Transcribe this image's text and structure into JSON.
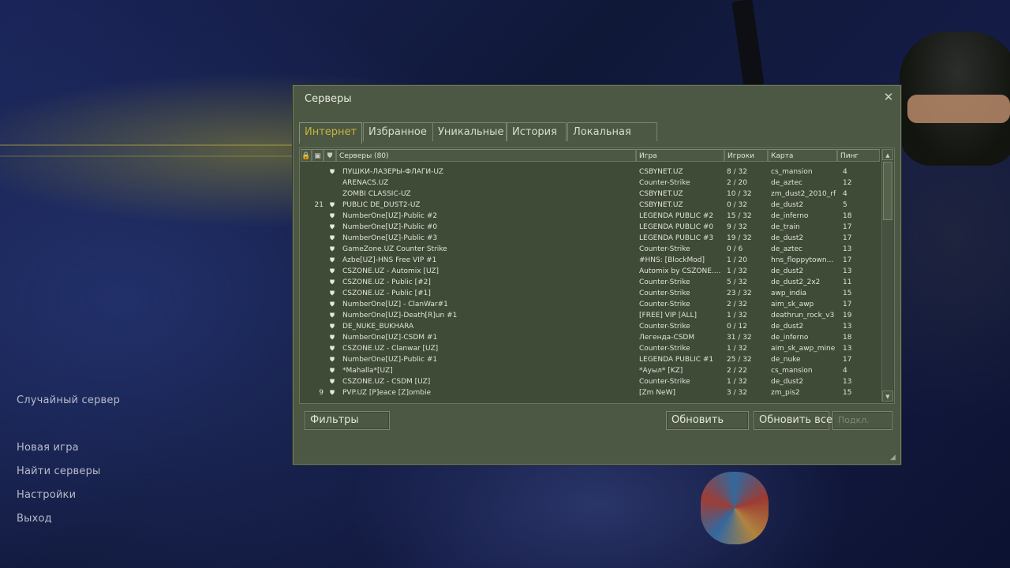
{
  "main_menu": {
    "random_server": "Случайный сервер",
    "items": [
      "Новая игра",
      "Найти серверы",
      "Настройки",
      "Выход"
    ]
  },
  "dialog": {
    "title": "Серверы",
    "close_icon": "close-icon",
    "tabs": [
      {
        "label": "Интернет",
        "active": true
      },
      {
        "label": "Избранное",
        "active": false
      },
      {
        "label": "Уникальные",
        "active": false
      },
      {
        "label": "История",
        "active": false
      },
      {
        "label": "Локальная сеть",
        "active": false
      }
    ],
    "columns": {
      "password_icon": "lock-icon",
      "bots_icon": "bot-icon",
      "secure_icon": "shield-icon",
      "servers": "Серверы (80)",
      "game": "Игра",
      "players": "Игроки",
      "map": "Карта",
      "ping": "Пинг"
    },
    "servers": [
      {
        "bots": "",
        "secure": true,
        "name": "ПУШКИ-ЛАЗЕРЫ-ФЛАГИ-UZ",
        "game": "CSBYNET.UZ",
        "players": "8 / 32",
        "map": "cs_mansion",
        "ping": "4"
      },
      {
        "bots": "",
        "secure": false,
        "name": "ARENACS.UZ",
        "game": "Counter-Strike",
        "players": "2 / 20",
        "map": "de_aztec",
        "ping": "12"
      },
      {
        "bots": "",
        "secure": false,
        "name": "ZOMBI CLASSIC-UZ",
        "game": "CSBYNET.UZ",
        "players": "10 / 32",
        "map": "zm_dust2_2010_rf",
        "ping": "4"
      },
      {
        "bots": "21",
        "secure": true,
        "name": "PUBLIC DE_DUST2-UZ",
        "game": "CSBYNET.UZ",
        "players": "0 / 32",
        "map": "de_dust2",
        "ping": "5"
      },
      {
        "bots": "",
        "secure": true,
        "name": "NumberOne[UZ]-Public #2",
        "game": "LEGENDA PUBLIC #2",
        "players": "15 / 32",
        "map": "de_inferno",
        "ping": "18"
      },
      {
        "bots": "",
        "secure": true,
        "name": "NumberOne[UZ]-Public #0",
        "game": "LEGENDA PUBLIC #0",
        "players": "9 / 32",
        "map": "de_train",
        "ping": "17"
      },
      {
        "bots": "",
        "secure": true,
        "name": "NumberOne[UZ]-Public #3",
        "game": "LEGENDA PUBLIC #3",
        "players": "19 / 32",
        "map": "de_dust2",
        "ping": "17"
      },
      {
        "bots": "",
        "secure": true,
        "name": "GameZone.UZ Counter Strike",
        "game": "Counter-Strike",
        "players": "0 / 6",
        "map": "de_aztec",
        "ping": "13"
      },
      {
        "bots": "",
        "secure": true,
        "name": "Azbe[UZ]-HNS Free VIP  #1",
        "game": "#HNS: [BlockMod]",
        "players": "1 / 20",
        "map": "hns_floppytown...",
        "ping": "17"
      },
      {
        "bots": "",
        "secure": true,
        "name": "CSZONE.UZ - Automix [UZ]",
        "game": "Automix by CSZONE....",
        "players": "1 / 32",
        "map": "de_dust2",
        "ping": "13"
      },
      {
        "bots": "",
        "secure": true,
        "name": "CSZONE.UZ - Public [#2]",
        "game": "Counter-Strike",
        "players": "5 / 32",
        "map": "de_dust2_2x2",
        "ping": "11"
      },
      {
        "bots": "",
        "secure": true,
        "name": "CSZONE.UZ - Public [#1]",
        "game": "Counter-Strike",
        "players": "23 / 32",
        "map": "awp_india",
        "ping": "15"
      },
      {
        "bots": "",
        "secure": true,
        "name": "NumberOne[UZ] - ClanWar#1",
        "game": "Counter-Strike",
        "players": "2 / 32",
        "map": "aim_sk_awp",
        "ping": "17"
      },
      {
        "bots": "",
        "secure": true,
        "name": "NumberOne[UZ]-Death[R]un #1",
        "game": "[FREE] VIP [ALL]",
        "players": "1 / 32",
        "map": "deathrun_rock_v3",
        "ping": "19"
      },
      {
        "bots": "",
        "secure": true,
        "name": "DE_NUKE_BUKHARA",
        "game": "Counter-Strike",
        "players": "0 / 12",
        "map": "de_dust2",
        "ping": "13"
      },
      {
        "bots": "",
        "secure": true,
        "name": "NumberOne[UZ]-CSDM #1",
        "game": "Легенда-CSDM",
        "players": "31 / 32",
        "map": "de_inferno",
        "ping": "18"
      },
      {
        "bots": "",
        "secure": true,
        "name": "CSZONE.UZ - Clanwar [UZ]",
        "game": "Counter-Strike",
        "players": "1 / 32",
        "map": "aim_sk_awp_mine",
        "ping": "13"
      },
      {
        "bots": "",
        "secure": true,
        "name": "NumberOne[UZ]-Public #1",
        "game": "LEGENDA PUBLIC #1",
        "players": "25 / 32",
        "map": "de_nuke",
        "ping": "17"
      },
      {
        "bots": "",
        "secure": true,
        "name": "*Mahalla*[UZ]",
        "game": "*Ауыл* [KZ]",
        "players": "2 / 22",
        "map": "cs_mansion",
        "ping": "4"
      },
      {
        "bots": "",
        "secure": true,
        "name": "CSZONE.UZ - CSDM [UZ]",
        "game": "Counter-Strike",
        "players": "1 / 32",
        "map": "de_dust2",
        "ping": "13"
      },
      {
        "bots": "9",
        "secure": true,
        "name": "PVP.UZ [P]eace [Z]ombie",
        "game": "[Zm NeW]",
        "players": "3 / 32",
        "map": "zm_pis2",
        "ping": "15"
      }
    ],
    "buttons": {
      "filters": "Фильтры",
      "refresh": "Обновить",
      "refresh_all": "Обновить все",
      "connect": "Подкл."
    }
  },
  "colors": {
    "panel": "#4c5844",
    "list_bg": "#3f4a37",
    "active_tab": "#c8b43c",
    "menu_text": "#b9bcc8"
  }
}
